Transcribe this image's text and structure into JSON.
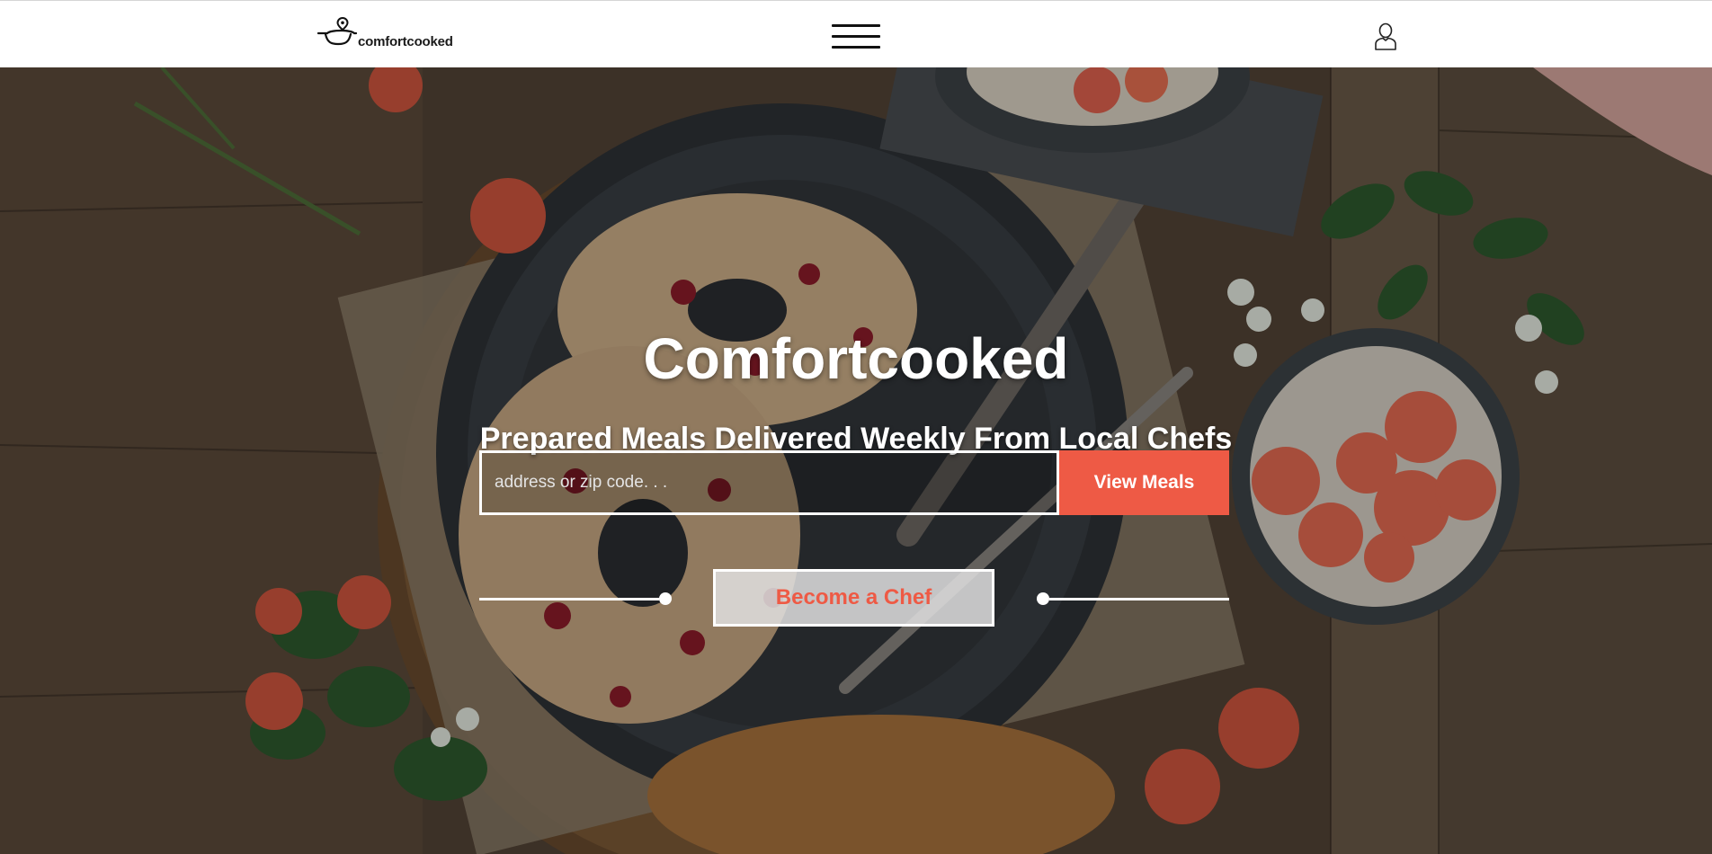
{
  "header": {
    "brand": "comfortcooked",
    "menu_label": "menu",
    "account_label": "account"
  },
  "hero": {
    "title": "Comfortcooked",
    "subtitle": "Prepared Meals Delivered Weekly From Local Chefs",
    "search": {
      "placeholder": "address or zip code. . .",
      "value": ""
    },
    "view_meals_label": "View Meals",
    "become_chef_label": "Become a Chef"
  },
  "colors": {
    "accent": "#ee5a45",
    "header_bg": "#ffffff",
    "text_light": "#ffffff"
  },
  "icons": {
    "logo": "pot-with-map-pin-icon",
    "menu": "hamburger-icon",
    "account": "user-icon"
  }
}
